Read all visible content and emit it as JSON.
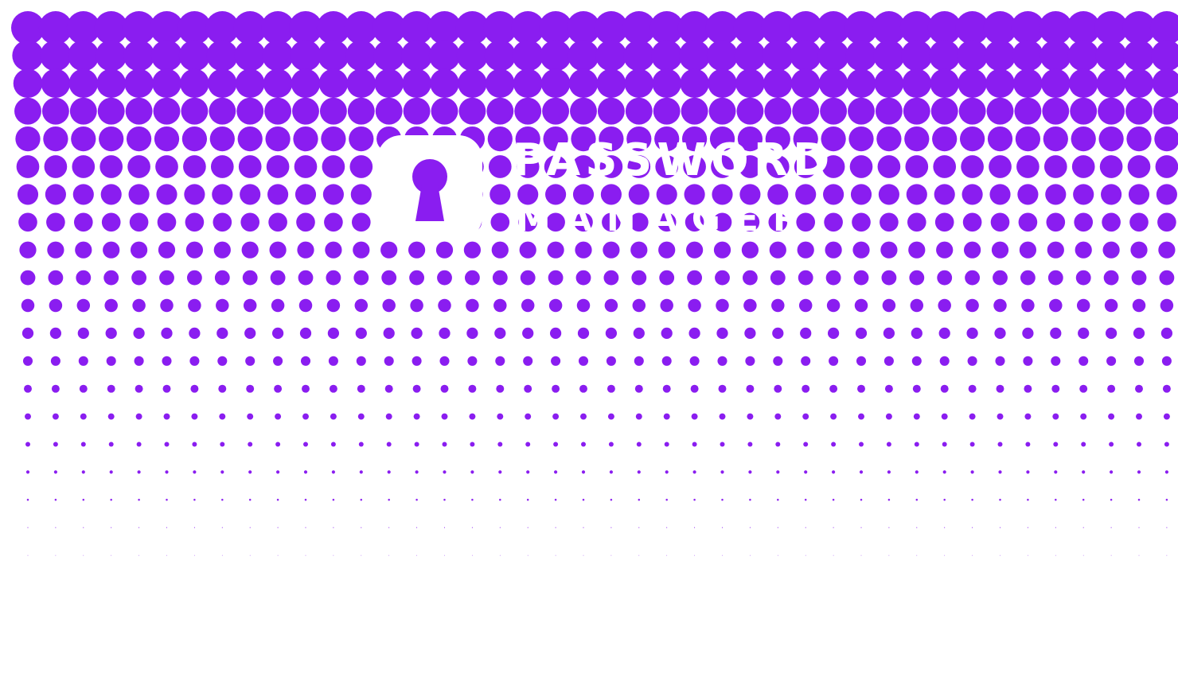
{
  "splash": {
    "title_line1": "PASSWORD",
    "title_line2": "MANAGER",
    "tagline": "",
    "version": ""
  },
  "logo": {
    "icon": "keyhole-lock-icon"
  },
  "colors": {
    "accent": "#8a1df0",
    "background": "#ffffff",
    "foreground": "#ffffff"
  }
}
